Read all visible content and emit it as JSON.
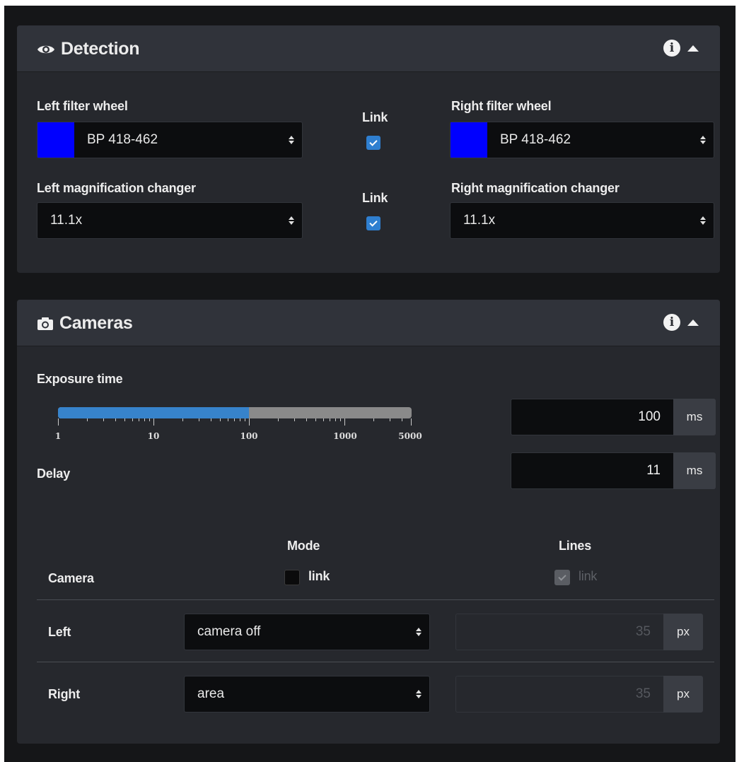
{
  "detection": {
    "title": "Detection",
    "left_filter_label": "Left filter wheel",
    "left_filter_value": "BP 418-462",
    "right_filter_label": "Right filter wheel",
    "right_filter_value": "BP 418-462",
    "filter_color": "#0000ff",
    "link_label_1": "Link",
    "link_label_2": "Link",
    "left_mag_label": "Left magnification changer",
    "left_mag_value": "11.1x",
    "right_mag_label": "Right magnification changer",
    "right_mag_value": "11.1x"
  },
  "cameras": {
    "title": "Cameras",
    "exposure_label": "Exposure time",
    "exposure_value": "100",
    "exposure_unit": "ms",
    "slider": {
      "min": 1,
      "max": 5000,
      "value": 100,
      "scale": "log",
      "tick_labels": [
        "1",
        "10",
        "100",
        "1000",
        "5000"
      ]
    },
    "delay_label": "Delay",
    "delay_value": "11",
    "delay_unit": "ms",
    "mode_label": "Mode",
    "lines_label": "Lines",
    "camera_label": "Camera",
    "mode_link_label": "link",
    "lines_link_label": "link",
    "rows": [
      {
        "label": "Left",
        "mode": "camera off",
        "lines": "35",
        "unit": "px"
      },
      {
        "label": "Right",
        "mode": "area",
        "lines": "35",
        "unit": "px"
      }
    ]
  }
}
